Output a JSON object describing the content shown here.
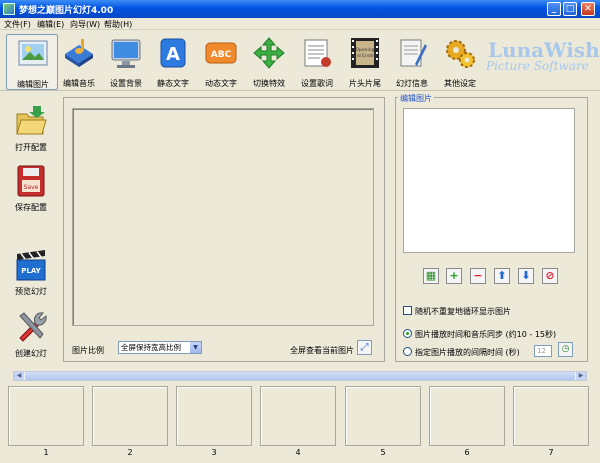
{
  "window": {
    "title": "梦想之巅图片幻灯4.00",
    "minimize": "_",
    "maximize": "□",
    "close": "✕"
  },
  "menu": [
    "文件(F)",
    "编辑(E)",
    "向导(W)",
    "帮助(H)"
  ],
  "toolbar": [
    {
      "label": "编辑图片",
      "icon": "photo-edit-icon"
    },
    {
      "label": "编辑音乐",
      "icon": "music-icon"
    },
    {
      "label": "设置背景",
      "icon": "monitor-icon"
    },
    {
      "label": "静态文字",
      "icon": "static-text-icon"
    },
    {
      "label": "动态文字",
      "icon": "dynamic-text-icon"
    },
    {
      "label": "切换特效",
      "icon": "transition-icon"
    },
    {
      "label": "设置歌词",
      "icon": "lyrics-icon"
    },
    {
      "label": "片头片尾",
      "icon": "film-icon"
    },
    {
      "label": "幻灯信息",
      "icon": "info-icon"
    },
    {
      "label": "其他设定",
      "icon": "gears-icon"
    }
  ],
  "film_text": {
    "line1": "Opening",
    "line2": "and Ending"
  },
  "logo": {
    "line1": "LunaWish",
    "line2": "Picture Software"
  },
  "sidebar": [
    {
      "label": "打开配置",
      "icon": "open-folder-icon"
    },
    {
      "label": "保存配置",
      "icon": "save-disk-icon",
      "icon_text": "Save"
    },
    {
      "label": "预览幻灯",
      "icon": "play-clapper-icon",
      "icon_text": "PLAY"
    },
    {
      "label": "创建幻灯",
      "icon": "tools-icon"
    }
  ],
  "center": {
    "ratio_label": "图片比例",
    "ratio_value": "全屏保持宽高比例",
    "fullscreen_label": "全屏查看当前图片"
  },
  "right_panel": {
    "title": "编辑图片",
    "buttons": [
      "grid",
      "add",
      "remove",
      "up",
      "down",
      "delete"
    ],
    "random_check": "随机不重复地循环显示图片",
    "sync_radio": "图片播放时间和音乐同步 (约10 - 15秒)",
    "interval_radio": "指定图片播放的间隔时间 (秒)",
    "interval_value": "12"
  },
  "thumbnails": [
    "1",
    "2",
    "3",
    "4",
    "5",
    "6",
    "7"
  ],
  "colors": {
    "titlebar": "#0054e3",
    "accent": "#2152c9",
    "background": "#ece9d8"
  }
}
